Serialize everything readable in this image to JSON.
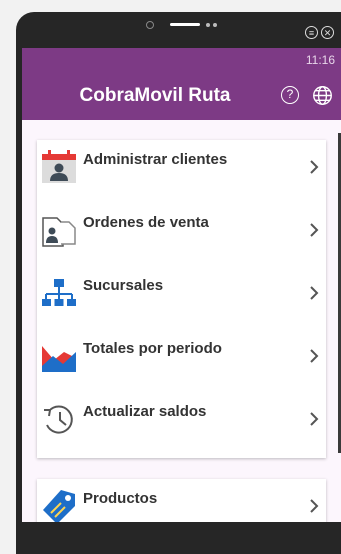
{
  "status_bar": {
    "time": "11:16"
  },
  "app_bar": {
    "title": "CobraMovil Ruta",
    "help_icon_glyph": "?"
  },
  "menu": [
    {
      "label": "Administrar clientes",
      "icon": "calendar-user-icon"
    },
    {
      "label": "Ordenes de venta",
      "icon": "document-user-icon"
    },
    {
      "label": "Sucursales",
      "icon": "org-chart-icon"
    },
    {
      "label": "Totales por periodo",
      "icon": "chart-icon"
    },
    {
      "label": "Actualizar saldos",
      "icon": "history-icon"
    }
  ],
  "secondary_menu": [
    {
      "label": "Productos",
      "icon": "tag-icon"
    }
  ],
  "colors": {
    "accent": "#7d3a85",
    "background": "#fcf6fd",
    "bezel": "#262626"
  }
}
